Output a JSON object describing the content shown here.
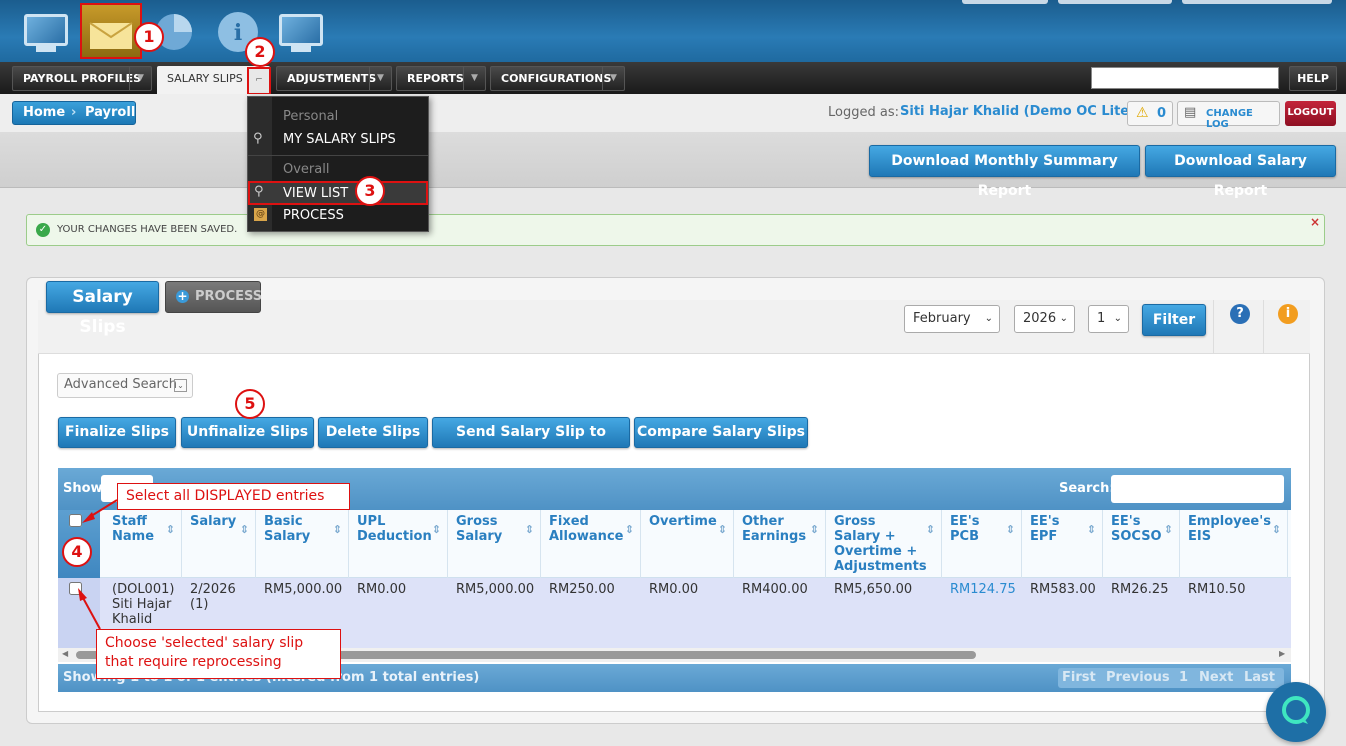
{
  "topnav": {
    "icons": [
      "monitor-icon",
      "envelope-icon",
      "pie-chart-icon",
      "info-icon",
      "monitor-icon"
    ]
  },
  "menubar": {
    "items": [
      "PAYROLL PROFILES",
      "SALARY SLIPS",
      "ADJUSTMENTS",
      "REPORTS",
      "CONFIGURATIONS"
    ],
    "help": "HELP"
  },
  "dropdown": {
    "section_personal": "Personal",
    "my_salary_slips": "MY SALARY SLIPS",
    "section_overall": "Overall",
    "view_list": "VIEW LIST",
    "process": "PROCESS"
  },
  "breadcrumb": {
    "home": "Home",
    "payroll": "Payroll"
  },
  "user": {
    "logged_as_label": "Logged as:",
    "name": "Siti Hajar Khalid (Demo OC Lite)",
    "alerts": "0",
    "change_log": "CHANGE LOG",
    "logout": "LOGOUT"
  },
  "actions": {
    "download_monthly": "Download Monthly Summary Report",
    "download_salary": "Download Salary Report"
  },
  "notice": {
    "text": "YOUR CHANGES HAVE BEEN SAVED.",
    "close": "×"
  },
  "panel": {
    "title": "Salary Slips",
    "process_btn": "PROCESS",
    "month": "February",
    "year": "2026",
    "period": "1",
    "filter": "Filter"
  },
  "advanced_search": "Advanced Search",
  "bulk": {
    "finalize": "Finalize Slips",
    "unfinalize": "Unfinalize Slips",
    "delete": "Delete Slips",
    "email": "Send Salary Slip to Email",
    "compare": "Compare Salary Slips"
  },
  "table": {
    "show_label": "Show",
    "search_label": "Search:",
    "columns": [
      "Staff Name",
      "Salary",
      "Basic Salary",
      "UPL Deduction",
      "Gross Salary",
      "Fixed Allowance",
      "Overtime",
      "Other Earnings",
      "Gross Salary + Overtime + Adjustments",
      "EE's PCB",
      "EE's EPF",
      "EE's SOCSO",
      "Employee's EIS"
    ],
    "row": {
      "staff": "(DOL001) Siti Hajar Khalid",
      "salary": "2/2026 (1)",
      "basic": "RM5,000.00",
      "upl": "RM0.00",
      "gross": "RM5,000.00",
      "fixed": "RM250.00",
      "overtime": "RM0.00",
      "other": "RM400.00",
      "gross_ot": "RM5,650.00",
      "pcb": "RM124.75",
      "epf": "RM583.00",
      "socso": "RM26.25",
      "eis": "RM10.50"
    },
    "footer_info": "Showing 1 to 1 of 1 entries (filtered from 1 total entries)",
    "pager": {
      "first": "First",
      "previous": "Previous",
      "page": "1",
      "next": "Next",
      "last": "Last"
    }
  },
  "annotations": {
    "a1": "1",
    "a2": "2",
    "a3": "3",
    "a4": "4",
    "a5": "5",
    "callout_select_all": "Select all DISPLAYED entries",
    "callout_choose": "Choose 'selected' salary slip that require reprocessing"
  }
}
